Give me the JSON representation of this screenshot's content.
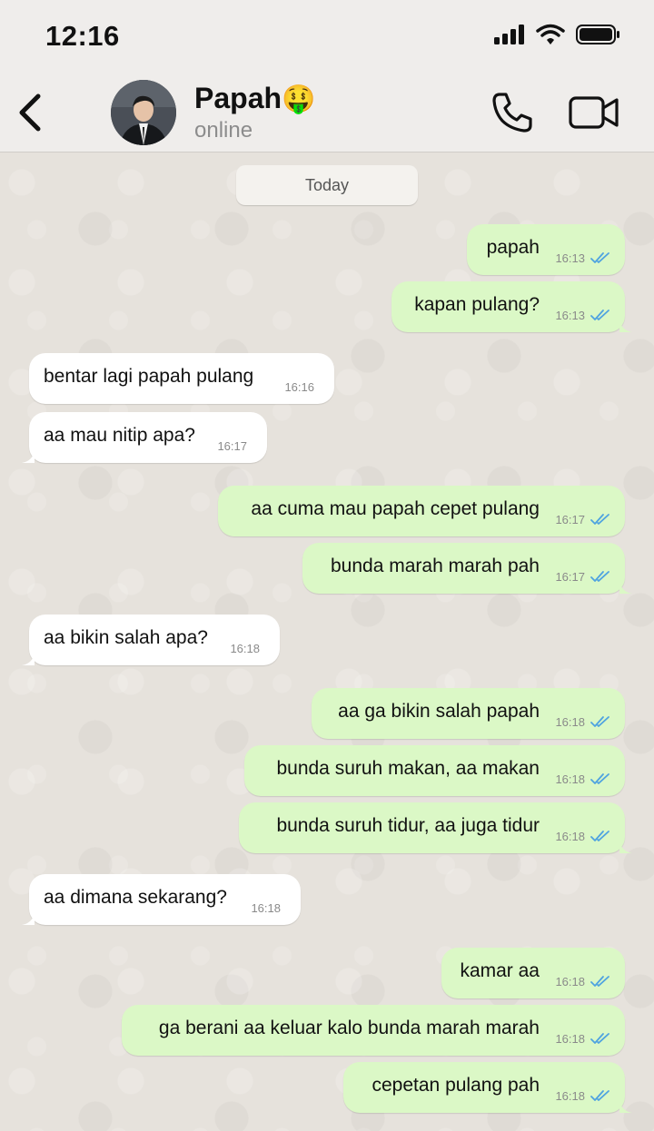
{
  "status_bar": {
    "time": "12:16"
  },
  "header": {
    "back_icon": "chevron-left-icon",
    "contact_name": "Papah",
    "contact_emoji": "🤑",
    "contact_status": "online",
    "call_icon": "phone-icon",
    "video_icon": "video-camera-icon"
  },
  "chat": {
    "date_label": "Today",
    "messages": [
      {
        "dir": "out",
        "text": "papah",
        "time": "16:13"
      },
      {
        "dir": "out",
        "text": "kapan pulang?",
        "time": "16:13"
      },
      {
        "dir": "in",
        "text": "bentar lagi papah pulang",
        "time": "16:16"
      },
      {
        "dir": "in",
        "text": "aa mau nitip apa?",
        "time": "16:17"
      },
      {
        "dir": "out",
        "text": "aa cuma mau papah cepet pulang",
        "time": "16:17"
      },
      {
        "dir": "out",
        "text": "bunda marah marah pah",
        "time": "16:17"
      },
      {
        "dir": "in",
        "text": "aa bikin salah apa?",
        "time": "16:18"
      },
      {
        "dir": "out",
        "text": "aa ga bikin salah papah",
        "time": "16:18"
      },
      {
        "dir": "out",
        "text": "bunda suruh makan, aa makan",
        "time": "16:18"
      },
      {
        "dir": "out",
        "text": "bunda suruh tidur, aa juga tidur",
        "time": "16:18"
      },
      {
        "dir": "in",
        "text": "aa dimana sekarang?",
        "time": "16:18"
      },
      {
        "dir": "out",
        "text": "kamar aa",
        "time": "16:18"
      },
      {
        "dir": "out",
        "text": "ga berani aa keluar kalo bunda marah marah",
        "time": "16:18"
      },
      {
        "dir": "out",
        "text": "cepetan pulang pah",
        "time": "16:18"
      }
    ]
  },
  "colors": {
    "outgoing_bubble": "#dbf8c6",
    "incoming_bubble": "#ffffff",
    "read_tick": "#4fa3e0",
    "header_bg": "#efedeb"
  }
}
